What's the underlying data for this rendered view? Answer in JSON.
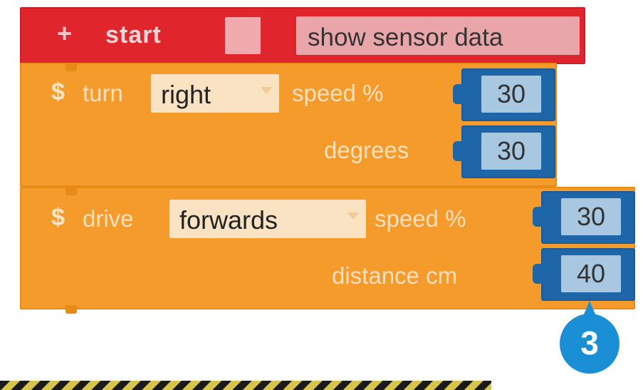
{
  "start_block": {
    "icon": "start-plus-icon",
    "label": "start",
    "value": "show sensor data"
  },
  "turn_block": {
    "label": "turn",
    "direction": "right",
    "speed_label": "speed %",
    "speed_value": "30",
    "degrees_label": "degrees",
    "degrees_value": "30"
  },
  "drive_block": {
    "label": "drive",
    "direction": "forwards",
    "speed_label": "speed %",
    "speed_value": "30",
    "distance_label": "distance cm",
    "distance_value": "40"
  },
  "step_marker": {
    "number": "3"
  },
  "colors": {
    "start_block": "#e0252d",
    "motion_block": "#f49b2c",
    "number_slot": "#1f66a8",
    "marker": "#1a8fd6"
  }
}
